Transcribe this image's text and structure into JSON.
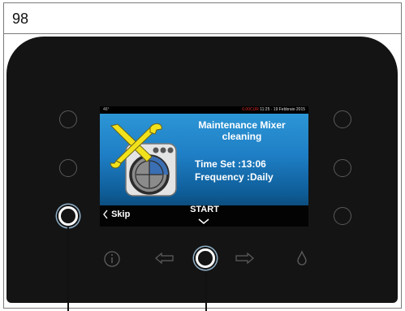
{
  "page_number": "98",
  "screen": {
    "status_bar": {
      "left_text": "46°",
      "alert_text": "0.00CUR",
      "time_date": "11:25 · 19 Febbraio 2015"
    },
    "title": "Maintenance Mixer cleaning",
    "time_set": "Time Set :13:06",
    "frequency": "Frequency :Daily",
    "skip_label": "Skip",
    "start_label": "START"
  },
  "colors": {
    "screen_top": "#2f9ad8",
    "screen_bottom": "#0a3454",
    "device_body": "#141414",
    "tool_icon": "#f2e21c"
  },
  "icons": [
    "info-icon",
    "arrow-left-icon",
    "confirm-button",
    "arrow-right-icon",
    "water-drop-icon",
    "maintenance-tools-icon"
  ]
}
